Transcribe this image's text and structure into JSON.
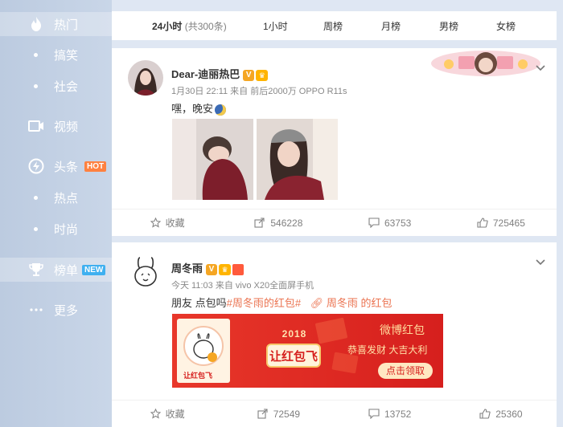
{
  "sidebar": {
    "items": [
      {
        "label": "热门",
        "icon": "flame-icon",
        "active": true
      },
      {
        "label": "搞笑"
      },
      {
        "label": "社会"
      },
      {
        "label": "视频",
        "icon": "video-camera-icon"
      },
      {
        "label": "头条",
        "icon": "lightning-icon",
        "badge": "HOT"
      },
      {
        "label": "热点"
      },
      {
        "label": "时尚"
      },
      {
        "label": "榜单",
        "icon": "trophy-icon",
        "badge": "NEW",
        "active": true
      },
      {
        "label": "更多",
        "icon": "more-dots-icon"
      }
    ]
  },
  "tabs": {
    "items": [
      {
        "label": "24小时",
        "count": "(共300条)",
        "active": true
      },
      {
        "label": "1小时"
      },
      {
        "label": "周榜"
      },
      {
        "label": "月榜"
      },
      {
        "label": "男榜"
      },
      {
        "label": "女榜"
      }
    ]
  },
  "posts": [
    {
      "author": "Dear-迪丽热巴",
      "meta": "1月30日 22:11 来自 前后2000万 OPPO R11s",
      "text": "嘿，晚安",
      "actions": {
        "collect": "收藏",
        "repost": "546228",
        "comment": "63753",
        "like": "725465"
      }
    },
    {
      "author": "周冬雨",
      "meta": "今天 11:03 来自 vivo X20全面屏手机",
      "text_prefix": "朋友 点包吗",
      "topic": "#周冬雨的红包#",
      "link": "周冬雨 的红包",
      "banner": {
        "year": "2018",
        "slogan": "让红包飞",
        "title": "微博红包",
        "subtitle": "恭喜发财 大吉大利",
        "cta": "点击领取",
        "logo_text": "让红包飞"
      },
      "actions": {
        "collect": "收藏",
        "repost": "72549",
        "comment": "13752",
        "like": "25360"
      }
    }
  ],
  "colors": {
    "accent": "#eb7350",
    "sidebar": "#c4d2e6",
    "hot": "#ff8140",
    "new": "#3fb0f0"
  }
}
